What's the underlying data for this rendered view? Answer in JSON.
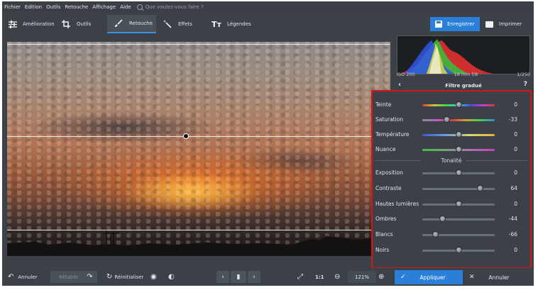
{
  "menubar": {
    "items": [
      "Fichier",
      "Edition",
      "Outils",
      "Retouche",
      "Affichage",
      "Aide"
    ],
    "search_placeholder": "Que voulez-vous faire ?"
  },
  "toolbar": {
    "tabs": [
      {
        "label": "Amélioration",
        "icon": "sliders-icon"
      },
      {
        "label": "Outils",
        "icon": "crop-icon"
      },
      {
        "label": "Retouche",
        "icon": "brush-icon",
        "active": true
      },
      {
        "label": "Effets",
        "icon": "magic-wand-icon"
      },
      {
        "label": "Légendes",
        "icon": "text-icon"
      }
    ],
    "save_label": "Enregistrer",
    "print_label": "Imprimer"
  },
  "exif": {
    "iso": "ISO 200",
    "lens": "18 mm f/8",
    "shutter": "1/250"
  },
  "panel": {
    "title": "Filtre gradué",
    "help": "?",
    "color_sliders": [
      {
        "label": "Teinte",
        "value": "0",
        "level": 0.5,
        "style": "hue"
      },
      {
        "label": "Saturation",
        "value": "-33",
        "level": 0.34,
        "style": "saturation"
      },
      {
        "label": "Température",
        "value": "0",
        "level": 0.5,
        "style": "temperature"
      },
      {
        "label": "Nuance",
        "value": "0",
        "level": 0.5,
        "style": "tint"
      }
    ],
    "section_title": "Tonalité",
    "tone_sliders": [
      {
        "label": "Exposition",
        "value": "0",
        "level": 0.5
      },
      {
        "label": "Contraste",
        "value": "64",
        "level": 0.8
      },
      {
        "label": "Hautes lumières",
        "value": "0",
        "level": 0.5
      },
      {
        "label": "Ombres",
        "value": "-44",
        "level": 0.28
      },
      {
        "label": "Blancs",
        "value": "-66",
        "level": 0.18
      },
      {
        "label": "Noirs",
        "value": "0",
        "level": 0.5
      }
    ]
  },
  "bottombar": {
    "undo_label": "Annuler",
    "redo_label": "Rétablir",
    "reset_label": "Réinitialiser",
    "zoom_ratio": "1:1",
    "zoom_level": "121%",
    "apply_label": "Appliquer",
    "cancel_label": "Annuler"
  },
  "colors": {
    "accent": "#2a7fd9",
    "highlight_border": "#d81418",
    "background": "#3c4147"
  }
}
